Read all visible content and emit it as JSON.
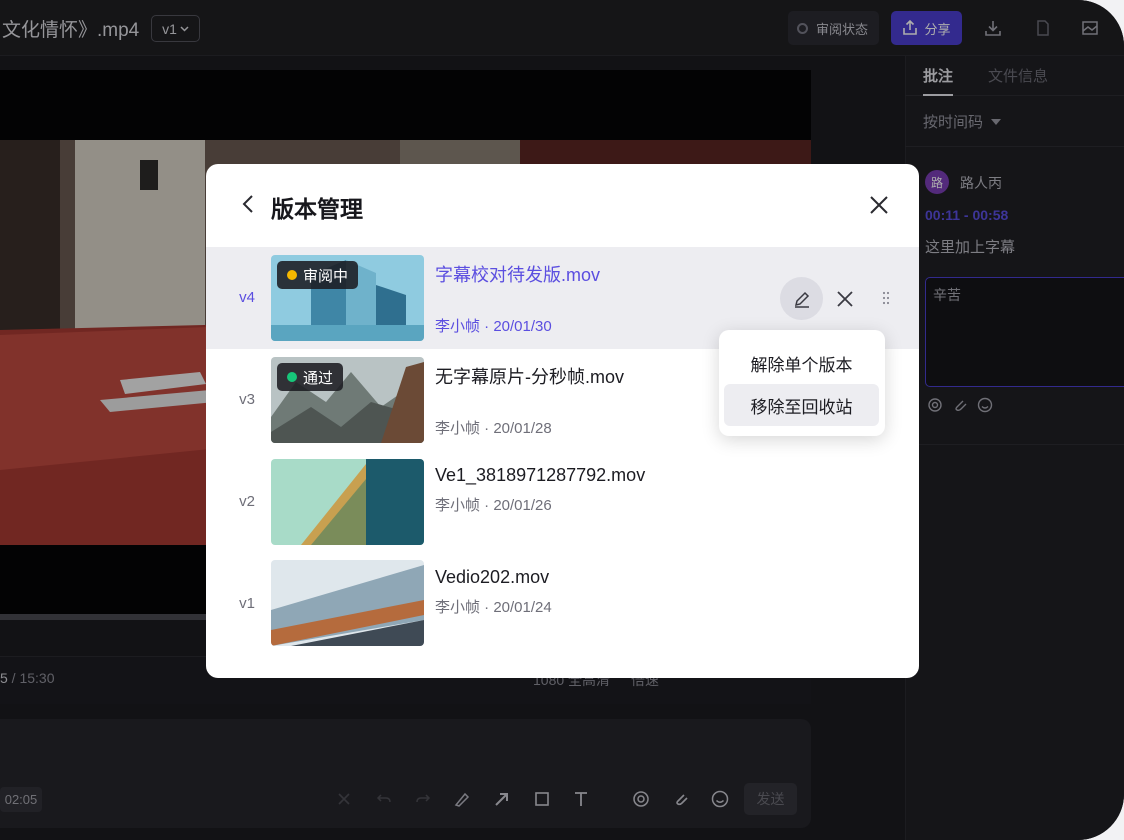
{
  "colors": {
    "accent": "#5b4ee0",
    "share_button": "#4c3fd1",
    "status_reviewing": "#f5b800",
    "status_approved": "#17c77a",
    "backdrop_dark": "#1b1b1f"
  },
  "header": {
    "file_title": "文化情怀》.mp4",
    "version_select": "v1",
    "review_status_label": "审阅状态",
    "share_label": "分享",
    "icons": [
      "download-icon",
      "copy-icon",
      "image-icon"
    ]
  },
  "player": {
    "timecode_current": "5",
    "timecode_total": " / 15:30",
    "quality": "1080 全高清",
    "speed": "倍速"
  },
  "comment_input": {
    "time_tag": "02:05",
    "send_label": "发送",
    "tools": [
      "clear-icon",
      "undo-icon",
      "redo-icon",
      "draw-icon",
      "arrow-icon",
      "rect-icon",
      "text-icon",
      "mention-icon",
      "attach-icon",
      "emoji-icon"
    ]
  },
  "right_panel": {
    "tab_comments": "批注",
    "tab_file_info": "文件信息",
    "sort_label": "按时间码",
    "comment": {
      "avatar_text": "路",
      "user": "路人丙",
      "time_range": "00:11 - 00:58",
      "text": "这里加上字幕"
    },
    "reply_text": "辛苦"
  },
  "modal": {
    "title": "版本管理",
    "versions": [
      {
        "version": "v4",
        "name": "字幕校对待发版.mov",
        "meta": "李小帧 · 20/01/30",
        "status": "审阅中",
        "status_color": "#f5b800",
        "active": true
      },
      {
        "version": "v3",
        "name": "无字幕原片-分秒帧.mov",
        "meta": "李小帧 · 20/01/28",
        "status": "通过",
        "status_color": "#17c77a",
        "active": false
      },
      {
        "version": "v2",
        "name": "Ve1_3818971287792.mov",
        "meta": "李小帧 · 20/01/26",
        "status": "",
        "active": false
      },
      {
        "version": "v1",
        "name": "Vedio202.mov",
        "meta": "李小帧 · 20/01/24",
        "status": "",
        "active": false
      }
    ],
    "menu": {
      "remove_single": "解除单个版本",
      "move_to_trash": "移除至回收站"
    }
  }
}
